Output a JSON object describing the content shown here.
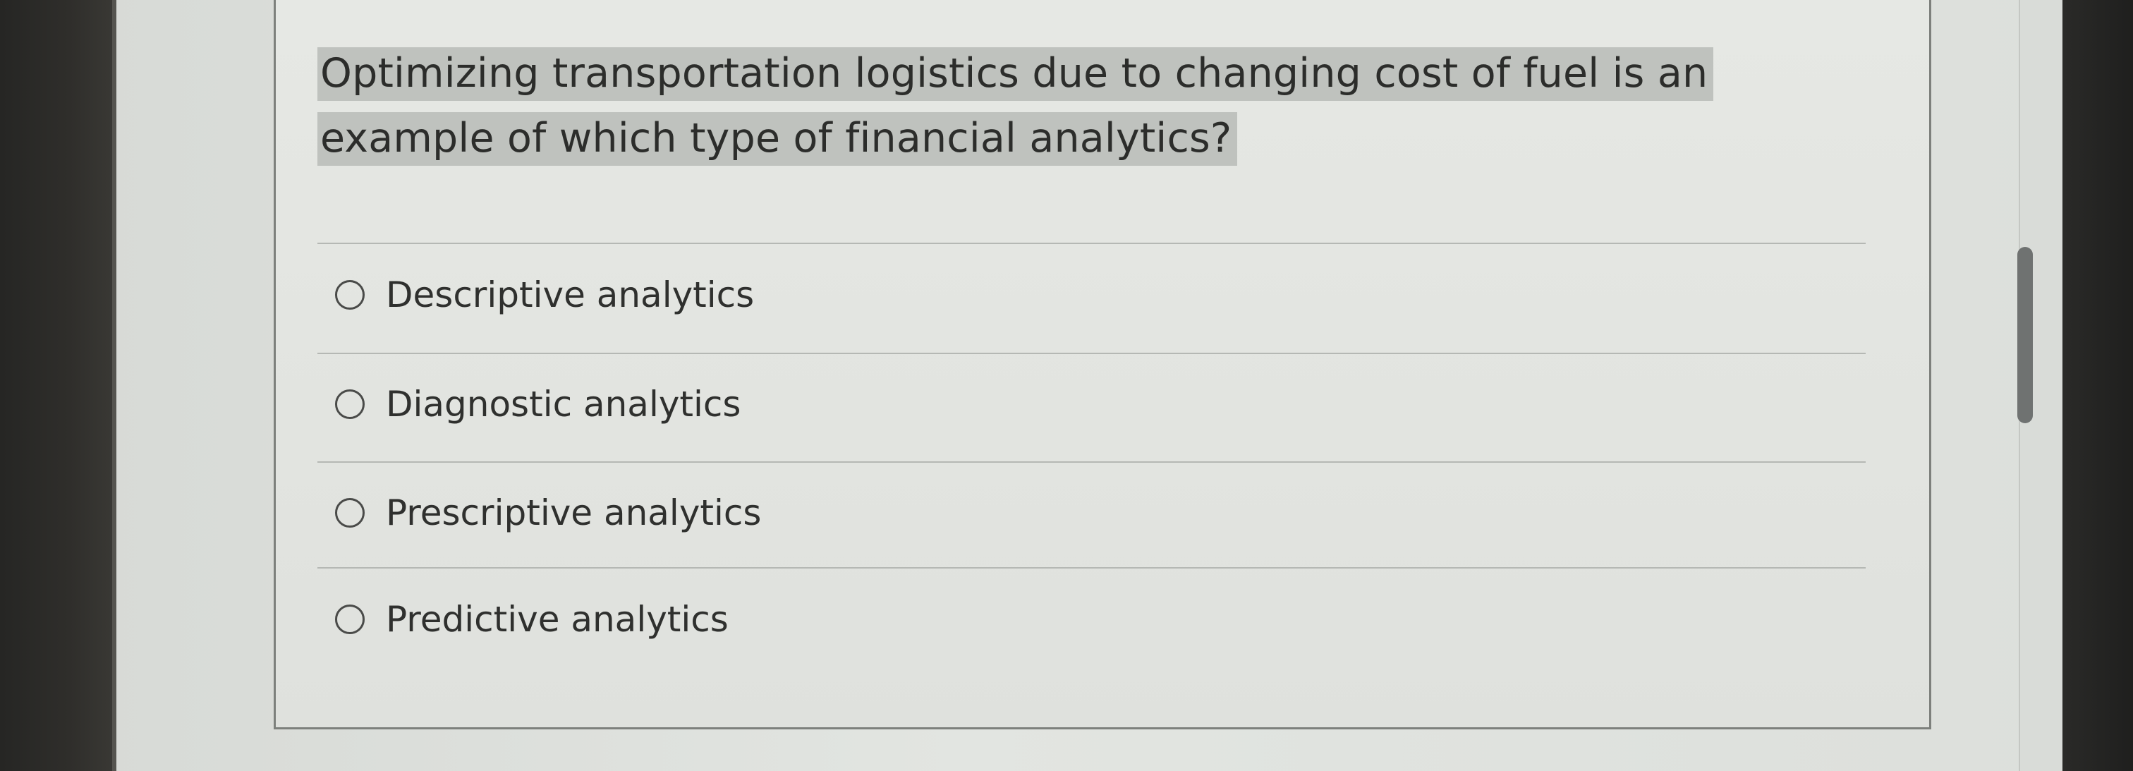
{
  "quiz": {
    "question": "Optimizing transportation logistics due to changing cost of fuel is an example of which type of financial analytics?",
    "options": [
      {
        "label": "Descriptive analytics",
        "selected": false
      },
      {
        "label": "Diagnostic analytics",
        "selected": false
      },
      {
        "label": "Prescriptive analytics",
        "selected": false
      },
      {
        "label": "Predictive analytics",
        "selected": false
      }
    ]
  },
  "colors": {
    "highlight": "#bfc2be",
    "text": "#2c2d2b",
    "card_border": "#7d807c"
  }
}
